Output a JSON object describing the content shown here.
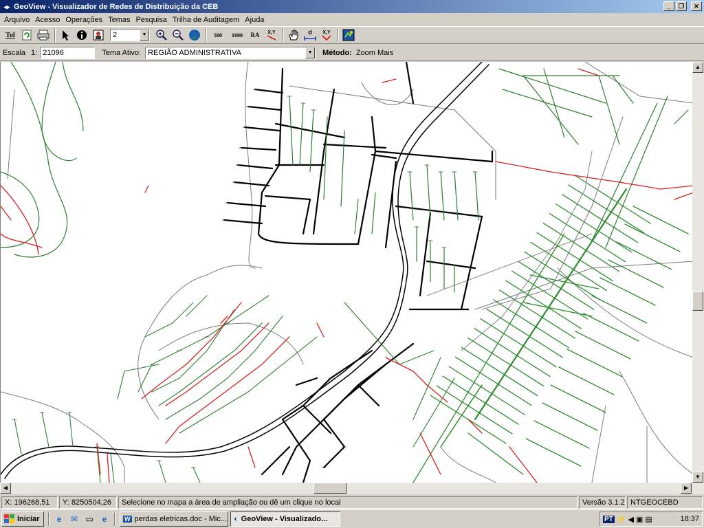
{
  "window": {
    "title": "GeoView - Visualizador de Redes de Distribuição da CEB",
    "min": "_",
    "max": "❐",
    "close": "✕"
  },
  "menu": [
    "Arquivo",
    "Acesso",
    "Operações",
    "Temas",
    "Pesquisa",
    "Trilha de Auditagem",
    "Ajuda"
  ],
  "toolbar": {
    "tol_label": "Tol",
    "layer_value": "2",
    "btn_500": "500",
    "btn_1000": "1000",
    "btn_ra": "RA",
    "btn_xy": "X,Y",
    "btn_xy2": "X,Y",
    "btn_d": "d"
  },
  "scale": {
    "label": "Escala",
    "ratio": "1:",
    "value": "21096",
    "tema_label": "Tema Ativo:",
    "tema_value": "REGIÃO ADMINISTRATIVA",
    "metodo_label": "Método:",
    "metodo_value": "Zoom Mais"
  },
  "status": {
    "x_label": "X:",
    "x_value": "196268,51",
    "y_label": "Y:",
    "y_value": "8250504,26",
    "message": "Selecione no mapa a área de ampliação ou dê um clique no local",
    "version": "Versão 3.1.2",
    "server": "NTGEOCEBD"
  },
  "taskbar": {
    "start": "Iniciar",
    "task1": "perdas eletricas.doc - Mic...",
    "task2": "GeoView - Visualizado...",
    "lang": "PT",
    "time": "18:37"
  },
  "icons": {
    "pointer": "arrow-pointer-icon",
    "info": "info-icon",
    "zoom_in": "zoom-in-icon",
    "zoom_out": "zoom-out-icon",
    "globe": "globe-icon",
    "hand": "pan-hand-icon"
  },
  "colors": {
    "title_start": "#0a246a",
    "title_end": "#a6caf0",
    "line_red": "#d42020",
    "line_green": "#2e8b2e",
    "line_black": "#000000",
    "line_gray": "#888888"
  }
}
